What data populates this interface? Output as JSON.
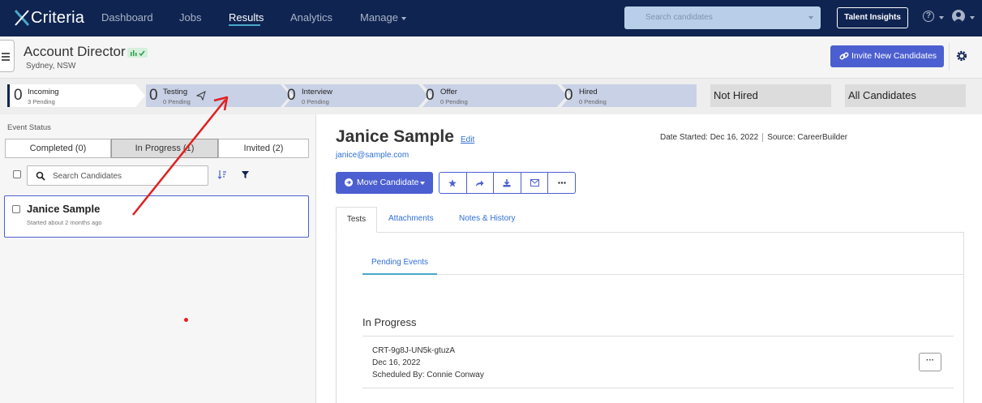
{
  "app": {
    "brand": "Criteria"
  },
  "nav": {
    "items": [
      {
        "label": "Dashboard"
      },
      {
        "label": "Jobs"
      },
      {
        "label": "Results"
      },
      {
        "label": "Analytics"
      },
      {
        "label": "Manage"
      }
    ],
    "active": "Results",
    "search_placeholder": "Search candidates",
    "talent_insights": "Talent Insights"
  },
  "job": {
    "title": "Account Director",
    "location": "Sydney, NSW",
    "invite_label": "Invite New Candidates"
  },
  "pipeline": {
    "stages": [
      {
        "count": "0",
        "name": "Incoming",
        "sub": "3 Pending"
      },
      {
        "count": "0",
        "name": "Testing",
        "sub": "0 Pending"
      },
      {
        "count": "0",
        "name": "Interview",
        "sub": "0 Pending"
      },
      {
        "count": "0",
        "name": "Offer",
        "sub": "0 Pending"
      },
      {
        "count": "0",
        "name": "Hired",
        "sub": "0 Pending"
      }
    ],
    "not_hired": "Not Hired",
    "all_candidates": "All Candidates"
  },
  "left": {
    "event_status_label": "Event Status",
    "segments": [
      "Completed (0)",
      "In Progress (1)",
      "Invited (2)"
    ],
    "search_placeholder": "Search Candidates",
    "candidate": {
      "name": "Janice Sample",
      "sub": "Started about 2 months ago"
    }
  },
  "candidate": {
    "name": "Janice Sample",
    "edit": "Edit",
    "email": "janice@sample.com",
    "date_started": "Date Started: Dec 16, 2022",
    "source": "Source: CareerBuilder",
    "move_label": "Move Candidate",
    "tabs": [
      "Tests",
      "Attachments",
      "Notes & History"
    ],
    "pending_events": "Pending Events",
    "in_progress_title": "In Progress",
    "event": {
      "code": "CRT-9g8J-UN5k-gtuzA",
      "date": "Dec 16, 2022",
      "scheduled_by": "Scheduled By: Connie Conway",
      "more": "···"
    }
  },
  "colors": {
    "nav_bg": "#0f2451",
    "primary": "#4c5fd0",
    "link": "#2f6fd6",
    "annotation": "#e02020"
  }
}
